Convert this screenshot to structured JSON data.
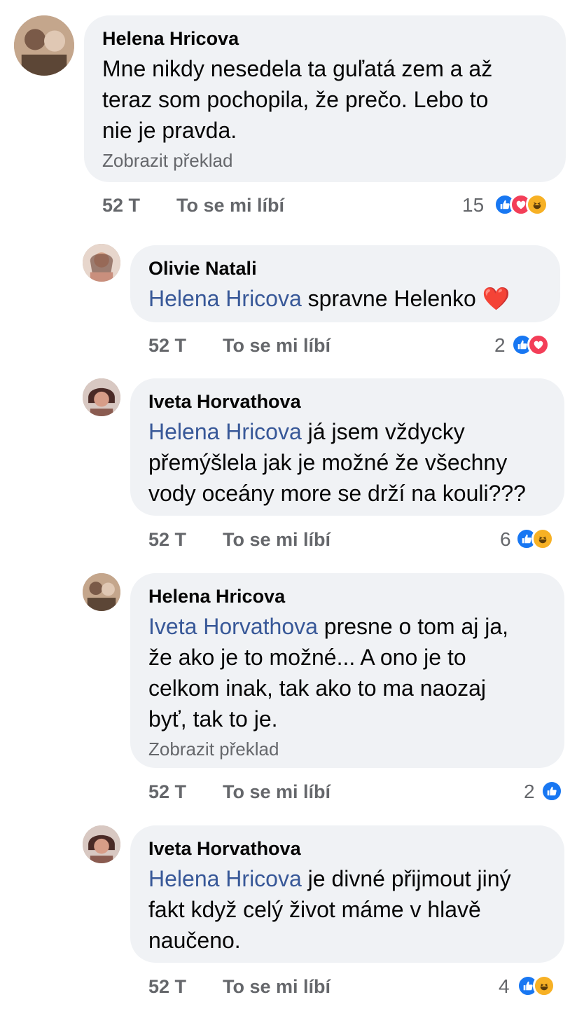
{
  "comments": [
    {
      "author": "Helena Hricova",
      "mention": "",
      "text_lines": [
        "Mne nikdy nesedela ta guľatá zem a až",
        "teraz som pochopila, že prečo. Lebo to",
        "nie je pravda."
      ],
      "translate": "Zobrazit překlad",
      "time": "52 T",
      "like_label": "To se mi líbí",
      "reaction_count": "15",
      "reactions": [
        "like",
        "love",
        "haha"
      ]
    },
    {
      "author": "Olivie Natali",
      "mention": "Helena Hricova",
      "text_lines": [
        " spravne Helenko ❤️"
      ],
      "translate": "",
      "time": "52 T",
      "like_label": "To se mi líbí",
      "reaction_count": "2",
      "reactions": [
        "like",
        "love"
      ]
    },
    {
      "author": "Iveta Horvathova",
      "mention": "Helena Hricova",
      "text_lines": [
        " já jsem vždycky",
        "přemýšlela jak je možné že všechny",
        "vody oceány more se drží na kouli???"
      ],
      "translate": "",
      "time": "52 T",
      "like_label": "To se mi líbí",
      "reaction_count": "6",
      "reactions": [
        "like",
        "haha"
      ]
    },
    {
      "author": "Helena Hricova",
      "mention": "Iveta Horvathova",
      "text_lines": [
        " presne o tom aj ja,",
        "že ako je to možné... A ono je to",
        "celkom inak, tak ako to ma naozaj",
        "byť, tak to je."
      ],
      "translate": "Zobrazit překlad",
      "time": "52 T",
      "like_label": "To se mi líbí",
      "reaction_count": "2",
      "reactions": [
        "like"
      ]
    },
    {
      "author": "Iveta Horvathova",
      "mention": "Helena Hricova",
      "text_lines": [
        " je divné přijmout jiný",
        "fakt když celý život máme v hlavě",
        "naučeno."
      ],
      "translate": "",
      "time": "52 T",
      "like_label": "To se mi líbí",
      "reaction_count": "4",
      "reactions": [
        "like",
        "haha"
      ]
    }
  ],
  "colors": {
    "bubble": "#f0f2f5",
    "mention": "#385898",
    "secondary_text": "#65676b",
    "like": "#1877f2",
    "love": "#f33e58",
    "haha": "#f7b125"
  }
}
